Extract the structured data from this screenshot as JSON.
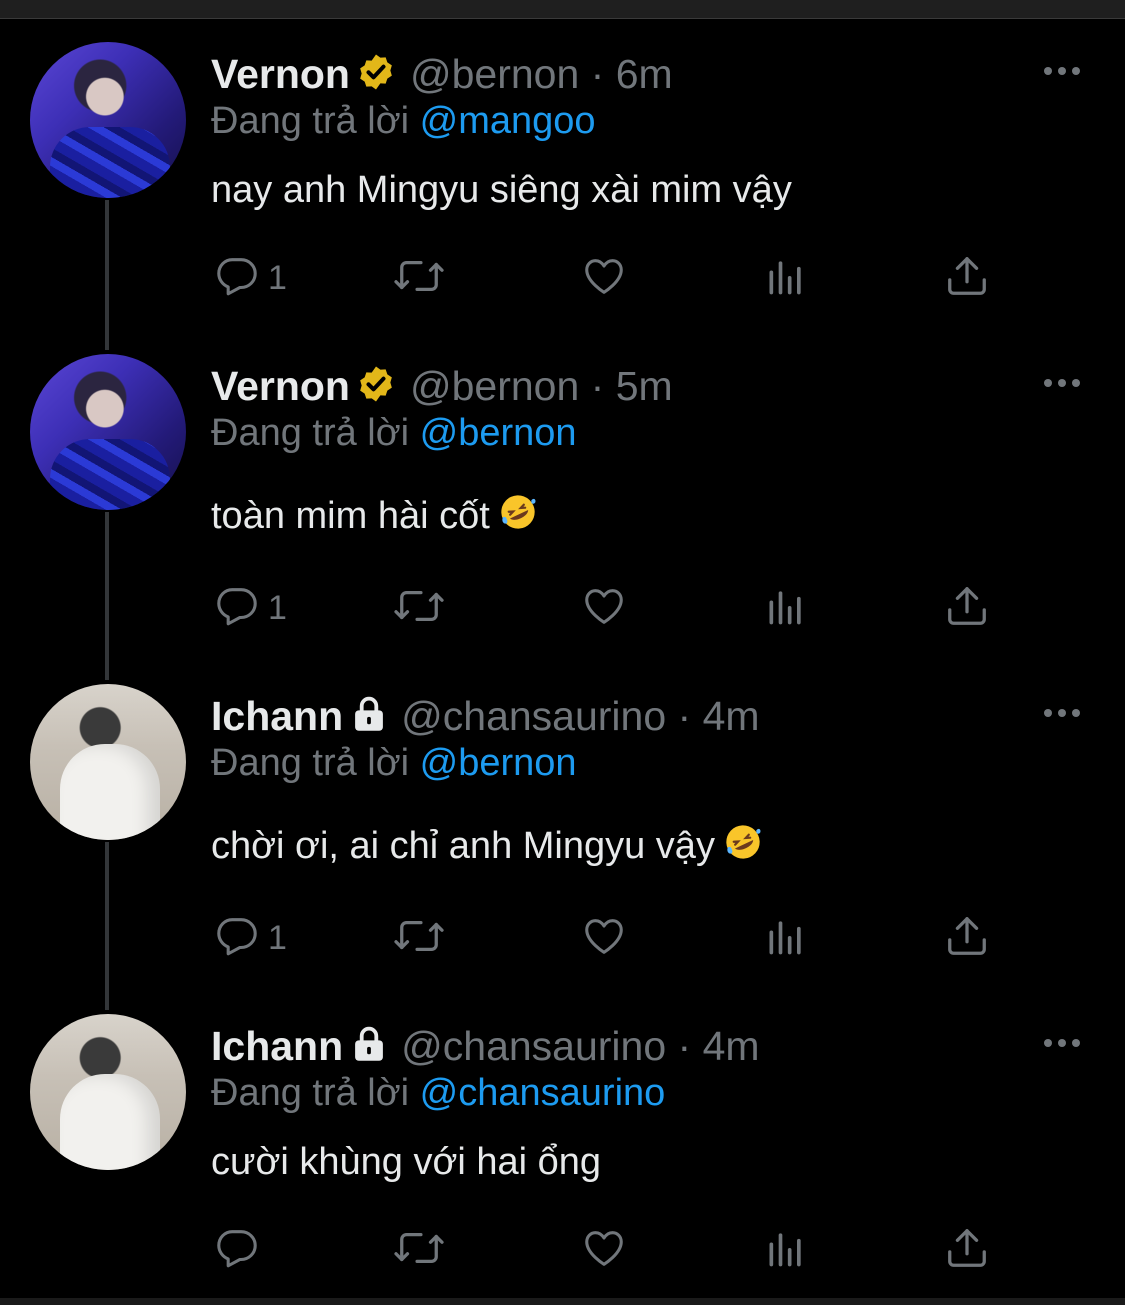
{
  "tweets": [
    {
      "name": "Vernon",
      "handle": "@bernon · 6m",
      "reply_prefix": "Đang trả lời",
      "reply_to": "@mangoo",
      "text": "nay anh Mingyu siêng xài mim vậy",
      "reply_count": "1",
      "badge": "verified-icon",
      "emoji": ""
    },
    {
      "name": "Vernon",
      "handle": "@bernon · 5m",
      "reply_prefix": "Đang trả lời",
      "reply_to": "@bernon",
      "text": "toàn mim hài cốt",
      "reply_count": "1",
      "badge": "verified-icon",
      "emoji": "rolling-on-floor-laughing-emoji"
    },
    {
      "name": "Ichann",
      "handle": "@chansaurino · 4m",
      "reply_prefix": "Đang trả lời",
      "reply_to": "@bernon",
      "text": "chời ơi, ai chỉ anh Mingyu vậy",
      "reply_count": "1",
      "badge": "lock-icon",
      "emoji": "rolling-on-floor-laughing-emoji"
    },
    {
      "name": "Ichann",
      "handle": "@chansaurino · 4m",
      "reply_prefix": "Đang trả lời",
      "reply_to": "@chansaurino",
      "text": "cười khùng với hai ổng",
      "reply_count": "",
      "badge": "lock-icon",
      "emoji": ""
    }
  ],
  "colors": {
    "background": "#000000",
    "text": "#e7e9ea",
    "muted": "#71767b",
    "link": "#1d9bf0",
    "verified": "#e2b719"
  }
}
